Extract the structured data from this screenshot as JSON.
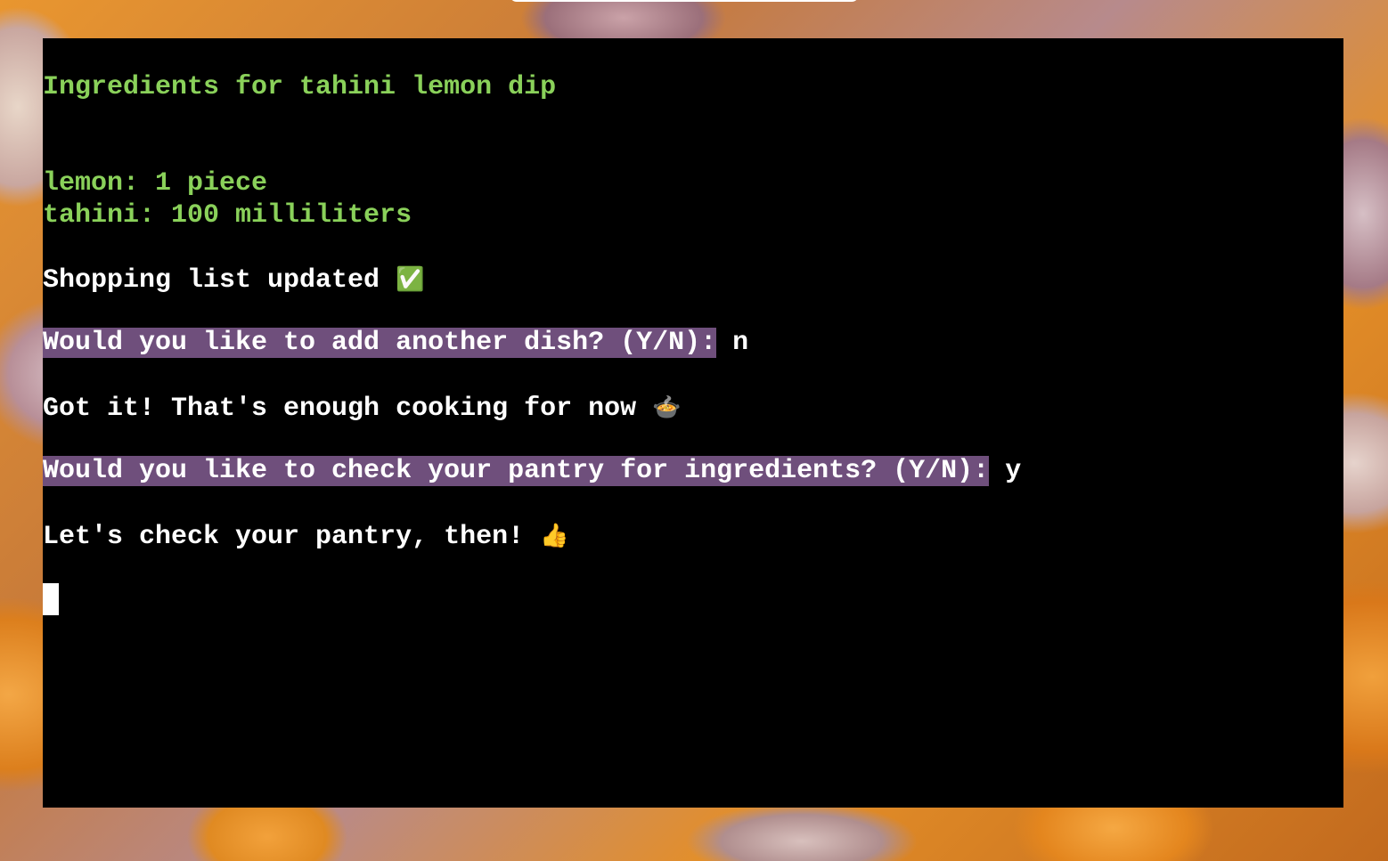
{
  "terminal": {
    "heading": "Ingredients for tahini lemon dip",
    "ingredients": [
      "lemon: 1 piece",
      "tahini: 100 milliliters"
    ],
    "shopping_status": "Shopping list updated",
    "shopping_status_icon": "✅",
    "prompt_add_dish": "Would you like to add another dish? (Y/N):",
    "answer_add_dish": " n",
    "done_cooking": "Got it! That's enough cooking for now",
    "done_cooking_icon": "🍲",
    "prompt_check_pantry": "Would you like to check your pantry for ingredients? (Y/N):",
    "answer_check_pantry": " y",
    "check_pantry_msg": "Let's check your pantry, then!",
    "check_pantry_icon": "👍"
  },
  "colors": {
    "terminal_bg": "#000000",
    "green_text": "#8ad15a",
    "prompt_highlight": "#6f4f7c",
    "text": "#ffffff"
  }
}
